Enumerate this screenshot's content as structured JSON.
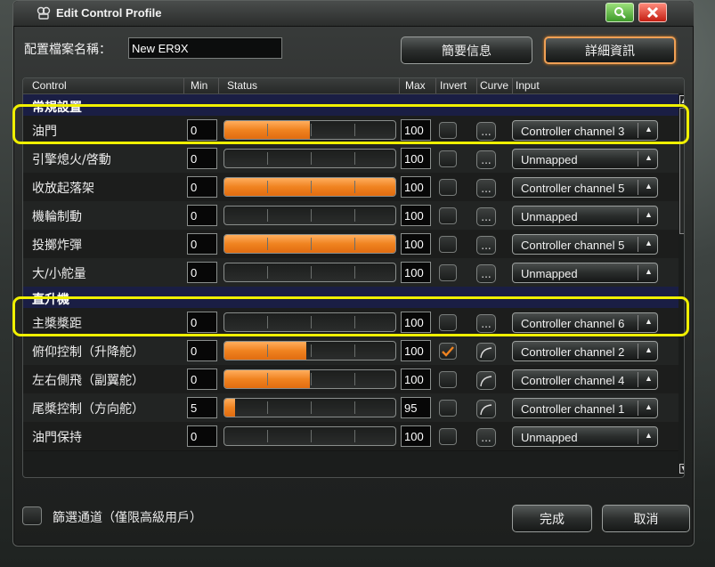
{
  "window": {
    "title": "Edit Control Profile"
  },
  "profile": {
    "label": "配置檔案名稱：",
    "name": "New ER9X"
  },
  "top_buttons": {
    "summary": "簡要信息",
    "detail": "詳細資訊"
  },
  "columns": {
    "control": "Control",
    "min": "Min",
    "status": "Status",
    "max": "Max",
    "invert": "Invert",
    "curve": "Curve",
    "input": "Input"
  },
  "curve_button_label": "...",
  "sections": [
    {
      "title": "常規設置",
      "rows": [
        {
          "name": "油門",
          "min": "0",
          "max": "100",
          "status_fill": 0.5,
          "invert": false,
          "curve_active": false,
          "input": "Controller channel 3",
          "highlighted": true
        },
        {
          "name": "引擎熄火/啓動",
          "min": "0",
          "max": "100",
          "status_fill": 0.0,
          "invert": false,
          "curve_active": false,
          "input": "Unmapped",
          "highlighted": false
        },
        {
          "name": "收放起落架",
          "min": "0",
          "max": "100",
          "status_fill": 1.0,
          "invert": false,
          "curve_active": false,
          "input": "Controller channel 5",
          "highlighted": false
        },
        {
          "name": "機輪制動",
          "min": "0",
          "max": "100",
          "status_fill": 0.0,
          "invert": false,
          "curve_active": false,
          "input": "Unmapped",
          "highlighted": false
        },
        {
          "name": "投擲炸彈",
          "min": "0",
          "max": "100",
          "status_fill": 1.0,
          "invert": false,
          "curve_active": false,
          "input": "Controller channel 5",
          "highlighted": false
        },
        {
          "name": "大/小舵量",
          "min": "0",
          "max": "100",
          "status_fill": 0.0,
          "invert": false,
          "curve_active": false,
          "input": "Unmapped",
          "highlighted": false
        }
      ]
    },
    {
      "title": "直升機",
      "rows": [
        {
          "name": "主槳槳距",
          "min": "0",
          "max": "100",
          "status_fill": 0.0,
          "invert": false,
          "curve_active": false,
          "input": "Controller channel 6",
          "highlighted": true
        },
        {
          "name": "俯仰控制（升降舵）",
          "min": "0",
          "max": "100",
          "status_fill": 0.48,
          "invert": true,
          "curve_active": true,
          "input": "Controller channel 2",
          "highlighted": false
        },
        {
          "name": "左右側飛（副翼舵）",
          "min": "0",
          "max": "100",
          "status_fill": 0.5,
          "invert": false,
          "curve_active": true,
          "input": "Controller channel 4",
          "highlighted": false
        },
        {
          "name": "尾槳控制（方向舵）",
          "min": "5",
          "max": "95",
          "status_fill": 0.06,
          "invert": false,
          "curve_active": true,
          "input": "Controller channel 1",
          "highlighted": false
        },
        {
          "name": "油門保持",
          "min": "0",
          "max": "100",
          "status_fill": 0.0,
          "invert": false,
          "curve_active": false,
          "input": "Unmapped",
          "highlighted": false
        }
      ]
    }
  ],
  "footer": {
    "filter_label": "篩選通道（僅限高級用戶）",
    "ok": "完成",
    "cancel": "取消"
  },
  "colors": {
    "accent": "#f08320",
    "highlight": "#f0f000",
    "section_bg": "#1a1e44"
  }
}
